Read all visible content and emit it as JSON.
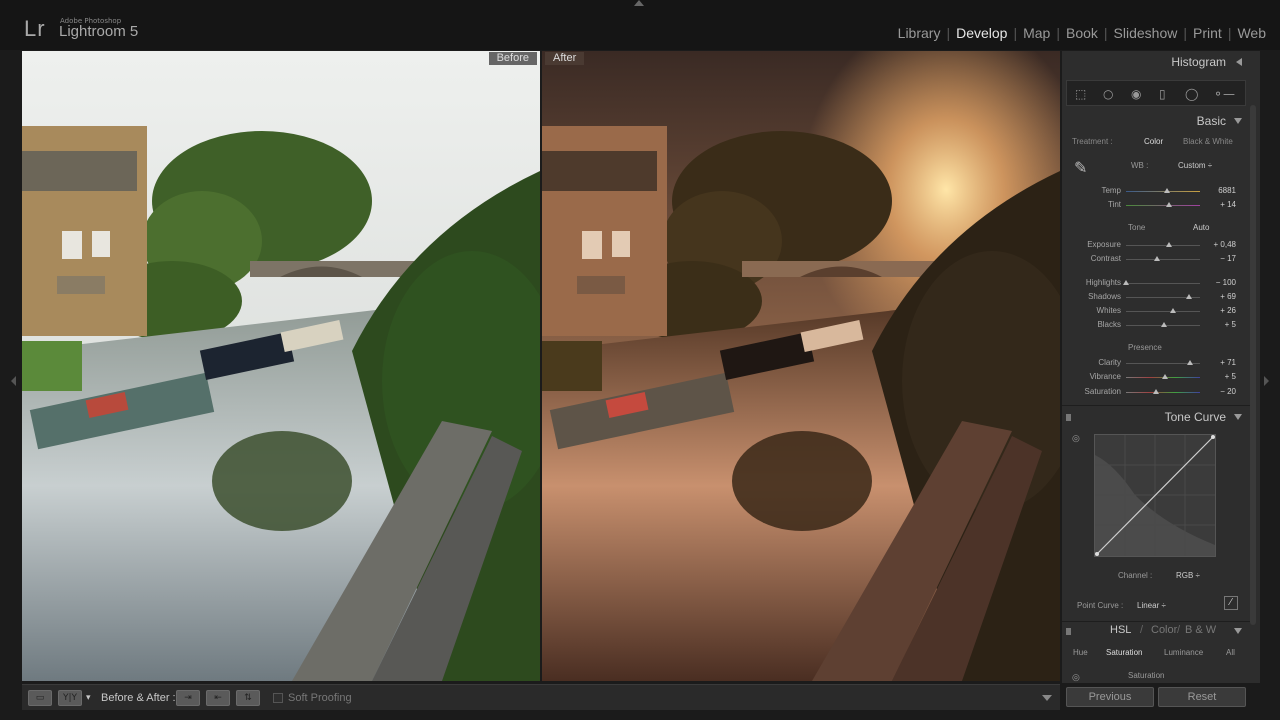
{
  "app": {
    "logo": "Lr",
    "vendor": "Adobe Photoshop",
    "title": "Lightroom 5"
  },
  "modules": [
    "Library",
    "Develop",
    "Map",
    "Book",
    "Slideshow",
    "Print",
    "Web"
  ],
  "active_module": "Develop",
  "view": {
    "before_label": "Before",
    "after_label": "After"
  },
  "toolbar": {
    "view_mode_icon": "loupe-icon",
    "compare_label": "Y|Y",
    "before_after_label": "Before & After :",
    "soft_proofing_label": "Soft Proofing"
  },
  "panel": {
    "histogram_title": "Histogram",
    "basic_title": "Basic",
    "treatment_label": "Treatment :",
    "treatment_color": "Color",
    "treatment_bw": "Black & White",
    "wb_label": "WB :",
    "wb_value": "Custom ÷",
    "temp": {
      "label": "Temp",
      "value": "6881"
    },
    "tint": {
      "label": "Tint",
      "value": "+ 14"
    },
    "tone_label": "Tone",
    "auto_label": "Auto",
    "exposure": {
      "label": "Exposure",
      "value": "+ 0,48"
    },
    "contrast": {
      "label": "Contrast",
      "value": "− 17"
    },
    "highlights": {
      "label": "Highlights",
      "value": "− 100"
    },
    "shadows": {
      "label": "Shadows",
      "value": "+ 69"
    },
    "whites": {
      "label": "Whites",
      "value": "+ 26"
    },
    "blacks": {
      "label": "Blacks",
      "value": "+ 5"
    },
    "presence_label": "Presence",
    "clarity": {
      "label": "Clarity",
      "value": "+ 71"
    },
    "vibrance": {
      "label": "Vibrance",
      "value": "+ 5"
    },
    "saturation": {
      "label": "Saturation",
      "value": "− 20"
    },
    "tone_curve_title": "Tone Curve",
    "channel_label": "Channel :",
    "channel_value": "RGB ÷",
    "point_curve_label": "Point Curve :",
    "point_curve_value": "Linear ÷",
    "hsl_title": "HSL",
    "color_title": "Color",
    "bw_title": "B & W",
    "hsl_tabs": [
      "Hue",
      "Saturation",
      "Luminance",
      "All"
    ],
    "hsl_active": "Saturation",
    "hsl_sub": "Saturation",
    "previous_label": "Previous",
    "reset_label": "Reset"
  },
  "slider_positions": {
    "temp": 0.55,
    "tint": 0.58,
    "exposure": 0.58,
    "contrast": 0.42,
    "highlights": 0.0,
    "shadows": 0.85,
    "whites": 0.63,
    "blacks": 0.52,
    "clarity": 0.86,
    "vibrance": 0.53,
    "saturation": 0.4
  }
}
